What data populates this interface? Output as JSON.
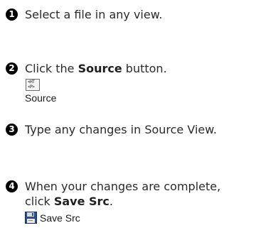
{
  "steps": [
    {
      "number": "1",
      "text": "Select a file in any view."
    },
    {
      "number": "2",
      "pre": "Click the ",
      "bold": "Source",
      "post": " button.",
      "icon": "html-source-icon",
      "icon_text_top": "<HT",
      "icon_text_bottom": "<P>",
      "button_label": "Source"
    },
    {
      "number": "3",
      "text": "Type any changes in Source View."
    },
    {
      "number": "4",
      "line1": "When your changes are complete,",
      "pre": "click ",
      "bold": "Save Src",
      "post": ".",
      "icon": "floppy-disk-icon",
      "button_label": "Save Src"
    }
  ]
}
